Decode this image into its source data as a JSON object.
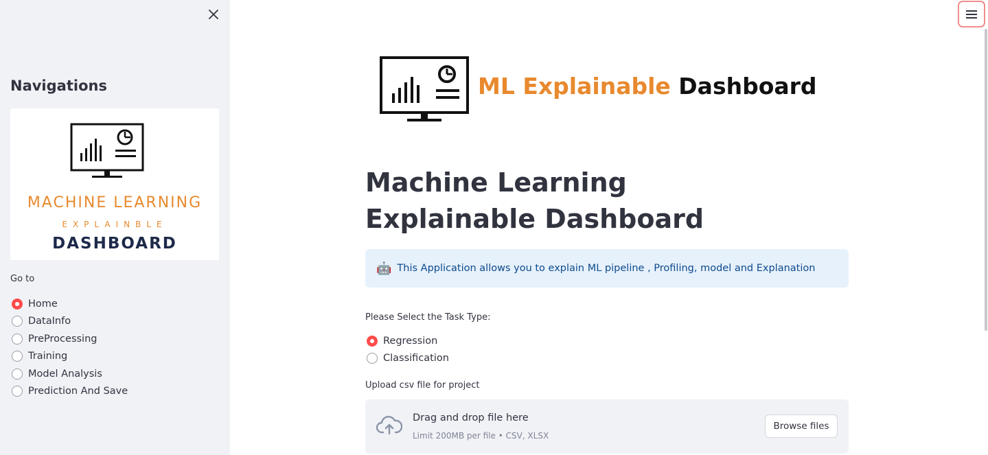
{
  "sidebar": {
    "title": "Navigations",
    "logo": {
      "line1": "MACHINE LEARNING",
      "line2": "EXPLAINBLE",
      "line3": "DASHBOARD"
    },
    "nav_label": "Go to",
    "items": [
      {
        "label": "Home",
        "selected": true
      },
      {
        "label": "DataInfo",
        "selected": false
      },
      {
        "label": "PreProcessing",
        "selected": false
      },
      {
        "label": "Training",
        "selected": false
      },
      {
        "label": "Model Analysis",
        "selected": false
      },
      {
        "label": "Prediction And Save",
        "selected": false
      }
    ]
  },
  "header_logo": {
    "part1": "ML Explainable",
    "part2": "Dashboard"
  },
  "main": {
    "title": "Machine Learning Explainable Dashboard",
    "info": {
      "emoji": "🤖",
      "text": "This Application allows you to explain ML pipeline , Profiling, model and Explanation"
    },
    "task": {
      "label": "Please Select the Task Type:",
      "options": [
        {
          "label": "Regression",
          "selected": true
        },
        {
          "label": "Classification",
          "selected": false
        }
      ]
    },
    "upload": {
      "label": "Upload csv file for project",
      "drop_title": "Drag and drop file here",
      "drop_sub": "Limit 200MB per file • CSV, XLSX",
      "browse_label": "Browse files"
    }
  },
  "colors": {
    "accent": "#ff4b4b",
    "logo_orange": "#e8892e",
    "info_bg": "#e6f1fc",
    "sidebar_bg": "#f0f2f6"
  },
  "icons": {
    "close": "close-icon",
    "menu": "hamburger-menu-icon",
    "upload": "cloud-upload-icon",
    "logo": "monitor-chart-icon"
  }
}
